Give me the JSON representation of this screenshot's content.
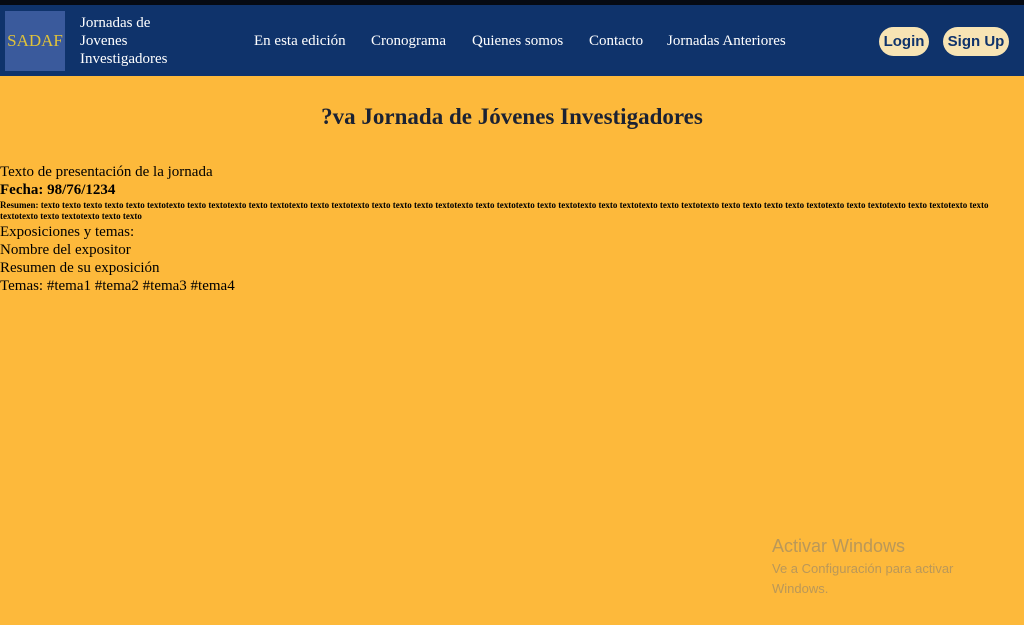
{
  "nav": {
    "logo_text": "SADAF",
    "brand_lines": [
      "Jornadas de",
      "Jovenes",
      "Investigadores"
    ],
    "links": [
      "En esta edición",
      "Cronograma",
      "Quienes somos",
      "Contacto",
      "Jornadas Anteriores"
    ],
    "login_label": "Login",
    "signup_label": "Sign Up"
  },
  "main": {
    "title": "?va Jornada de Jóvenes Investigadores",
    "presentation": "Texto de presentación de la jornada",
    "fecha": "Fecha: 98/76/1234",
    "resumen": "Resumen: texto texto texto texto texto textotexto texto textotexto texto textotexto texto textotexto texto texto texto textotexto texto textotexto texto textotexto texto textotexto texto textotexto texto texto texto texto textotexto texto textotexto texto textotexto texto textotexto texto textotexto texto texto",
    "exposiciones_label": "Exposiciones y temas:",
    "expositor": "Nombre del expositor",
    "resumen_exposicion": "Resumen de su exposición",
    "temas": "Temas: #tema1 #tema2 #tema3 #tema4"
  },
  "watermark": {
    "title": "Activar Windows",
    "subtitle": "Ve a Configuración para activar Windows."
  },
  "colors": {
    "navbar": "#0f336b",
    "background": "#fdb93b",
    "button_bg": "#f7e4b4",
    "logo_bg": "#3a5a9c",
    "logo_text": "#e0c23a"
  }
}
